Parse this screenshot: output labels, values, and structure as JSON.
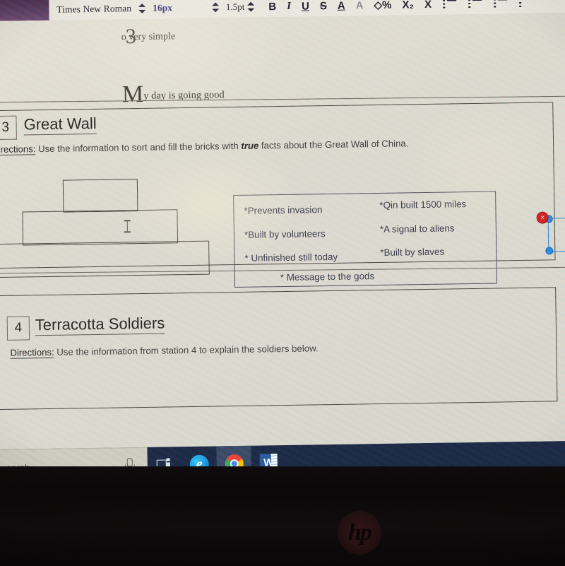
{
  "device": {
    "brand_logo": "hp",
    "brand_logo_icon": "hp-logo"
  },
  "editor_toolbar": {
    "font_family": "Times New Roman",
    "font_size": "16px",
    "line_height": "1.5pt",
    "font_family_stepper_icon": "stepper-up-down-icon",
    "font_size_stepper_icon": "stepper-up-down-icon",
    "line_height_stepper_icon": "stepper-up-down-icon",
    "buttons": [
      {
        "label": "B",
        "name": "bold-icon"
      },
      {
        "label": "I",
        "name": "italic-icon"
      },
      {
        "label": "U",
        "name": "underline-icon"
      },
      {
        "label": "S",
        "name": "strikethrough-icon"
      },
      {
        "label": "A",
        "name": "text-color-icon"
      },
      {
        "label": "A",
        "name": "highlight-color-icon"
      },
      {
        "label": "◇%",
        "name": "code-icon"
      },
      {
        "label": "X₂",
        "name": "subscript-icon"
      },
      {
        "label": "X",
        "name": "superscript-icon"
      }
    ],
    "list_buttons": [
      {
        "name": "bulleted-list-icon"
      },
      {
        "name": "numbered-list-icon"
      },
      {
        "name": "indent-icon"
      },
      {
        "name": "outdent-icon"
      }
    ]
  },
  "document": {
    "clipped_line_top": "o very simple",
    "clipped_line_dropcap": "3",
    "paragraph": {
      "dropcap": "M",
      "text": "y day is going good"
    },
    "sections": [
      {
        "number": "3",
        "title": "Great Wall",
        "directions_label": "Directions:",
        "directions_text_before": " Use the information to sort and fill the bricks with ",
        "directions_emphasis": "true",
        "directions_text_after": " facts about the Great Wall of China."
      },
      {
        "number": "4",
        "title": "Terracotta Soldiers",
        "directions_label": "Directions:",
        "directions_text_before": " Use the information from station 4 to explain the soldiers below.",
        "directions_emphasis": "",
        "directions_text_after": ""
      }
    ],
    "bricks": [
      {
        "name": "brick-top"
      },
      {
        "name": "brick-middle"
      },
      {
        "name": "brick-bottom"
      }
    ],
    "facts_box": {
      "facts_column_left": [
        "*Prevents invasion",
        "*Built by volunteers",
        "* Unfinished still today"
      ],
      "facts_column_right": [
        "*Qin built 1500 miles",
        "*A signal to aliens",
        "*Built by slaves"
      ],
      "fact_centered": "* Message to the gods"
    },
    "text_cursor_icon": "i-beam-cursor-icon",
    "selection": {
      "delete_badge_label": "×",
      "delete_badge_icon": "delete-badge-icon",
      "handle_icon": "resize-handle-icon",
      "accent_color": "#2b86df",
      "delete_color": "#cf2222"
    }
  },
  "taskbar": {
    "search_placeholder": "search",
    "search_value": "",
    "microphone_icon": "microphone-icon",
    "items": [
      {
        "label": "Task View",
        "icon": "task-view-icon",
        "active": false
      },
      {
        "label": "Microsoft Edge",
        "icon": "edge-icon",
        "active": true
      },
      {
        "label": "Google Chrome",
        "icon": "chrome-icon",
        "active": true
      },
      {
        "label": "Microsoft Word",
        "icon": "word-icon",
        "active": true
      }
    ],
    "background_color": "#1e2a44"
  }
}
